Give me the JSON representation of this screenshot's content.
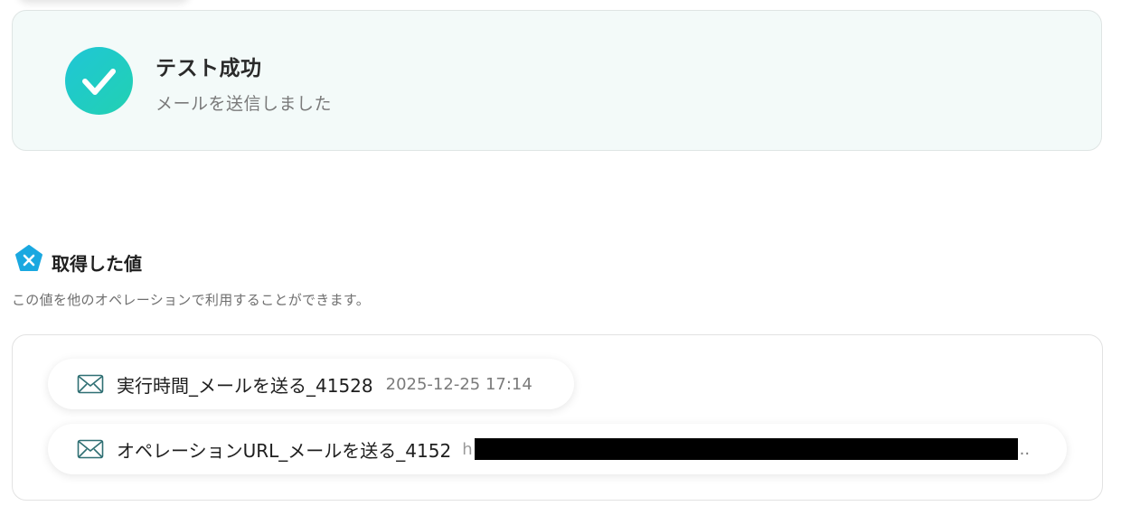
{
  "success": {
    "title": "テスト成功",
    "message": "メールを送信しました",
    "icon": "checkmark-icon",
    "accent_colors": [
      "#1fc6d6",
      "#22d1b2"
    ]
  },
  "section": {
    "icon": "yoom-logo-icon",
    "title": "取得した値",
    "description": "この値を他のオペレーションで利用することができます。"
  },
  "values": [
    {
      "icon": "mail-icon",
      "name": "実行時間_メールを送る_41528",
      "value": "2025-12-25 17:14"
    },
    {
      "icon": "mail-icon",
      "name": "オペレーションURL_メールを送る_4152",
      "value_prefix": "h",
      "value_ellipsis": ".."
    }
  ]
}
